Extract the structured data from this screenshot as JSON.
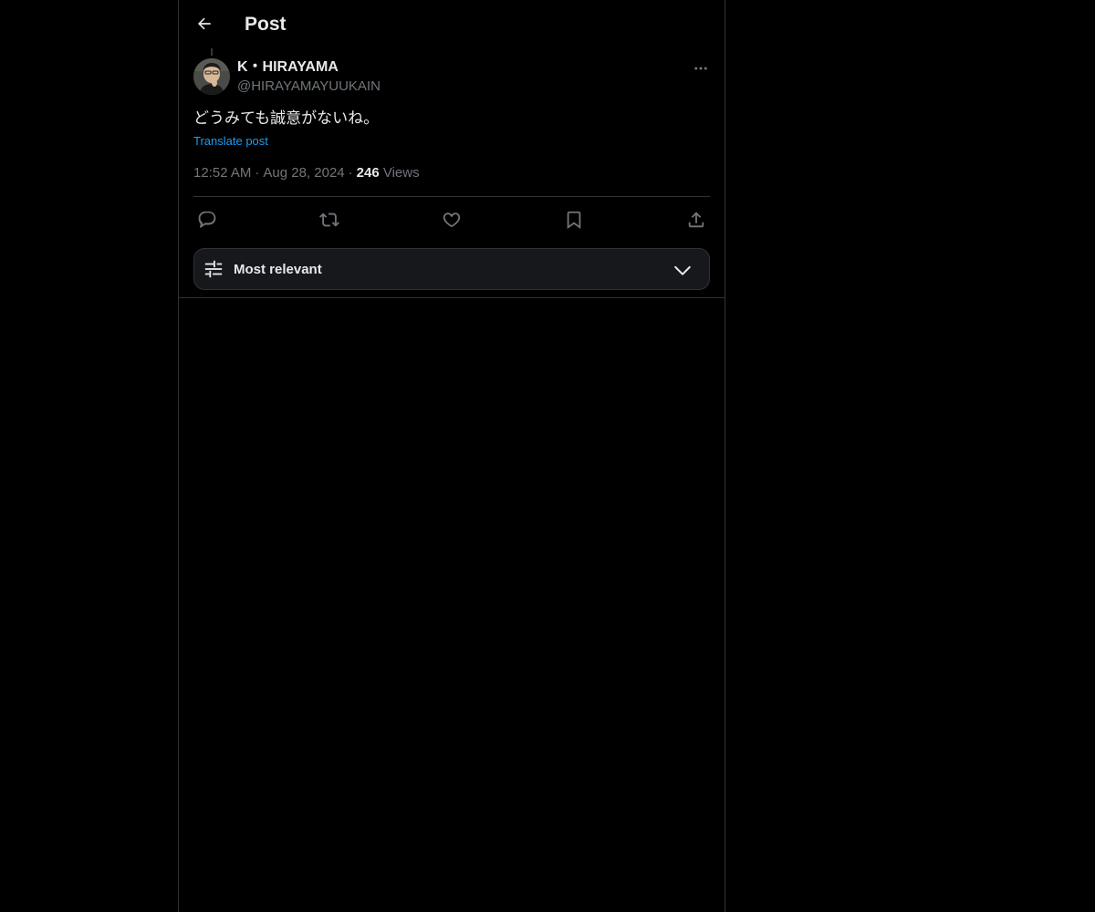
{
  "header": {
    "back_icon": "arrow-left-icon",
    "title": "Post"
  },
  "post": {
    "author": {
      "name": "K・HIRAYAMA",
      "handle": "@HIRAYAMAYUUKAIN",
      "avatar_icon": "avatar-photo"
    },
    "more_icon": "more-horizontal-icon",
    "text": "どうみても誠意がないね。",
    "translate_label": "Translate post",
    "time": "12:52 AM",
    "separator": "·",
    "date": "Aug 28, 2024",
    "views_count": "246",
    "views_label": "Views"
  },
  "actions": [
    {
      "name": "reply",
      "icon": "reply-icon"
    },
    {
      "name": "repost",
      "icon": "repost-icon"
    },
    {
      "name": "like",
      "icon": "heart-icon"
    },
    {
      "name": "bookmark",
      "icon": "bookmark-icon"
    },
    {
      "name": "share",
      "icon": "share-icon"
    }
  ],
  "sort": {
    "icon": "sliders-icon",
    "label": "Most relevant",
    "chevron_icon": "chevron-down-icon"
  },
  "colors": {
    "background": "#000000",
    "text_primary": "#e7e9ea",
    "text_secondary": "#71767b",
    "link": "#1d9bf0",
    "border": "#2f3336"
  }
}
